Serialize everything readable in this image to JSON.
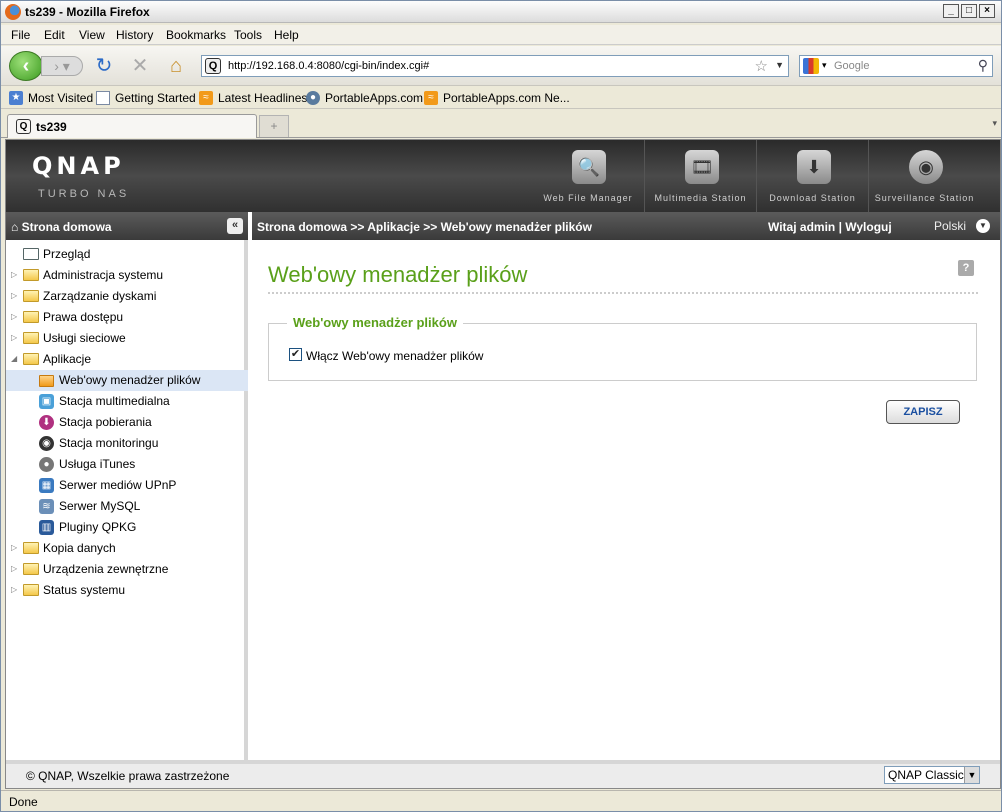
{
  "window": {
    "title": "ts239 - Mozilla Firefox"
  },
  "menu": [
    "File",
    "Edit",
    "View",
    "History",
    "Bookmarks",
    "Tools",
    "Help"
  ],
  "nav": {
    "url": "http://192.168.0.4:8080/cgi-bin/index.cgi#",
    "search_placeholder": "Google"
  },
  "bookmarks": [
    "Most Visited",
    "Getting Started",
    "Latest Headlines",
    "PortableApps.com",
    "PortableApps.com Ne..."
  ],
  "tab": {
    "label": "ts239",
    "new_tab": "+"
  },
  "qnap": {
    "logo": "QNAP",
    "sub": "TURBO NAS",
    "apps": [
      "Web File Manager",
      "Multimedia Station",
      "Download Station",
      "Surveillance Station"
    ]
  },
  "sidebar": {
    "header": "Strona domowa",
    "items": [
      {
        "label": "Przegląd"
      },
      {
        "label": "Administracja systemu"
      },
      {
        "label": "Zarządzanie dyskami"
      },
      {
        "label": "Prawa dostępu"
      },
      {
        "label": "Usługi sieciowe"
      },
      {
        "label": "Aplikacje"
      },
      {
        "label": "Web'owy menadżer plików"
      },
      {
        "label": "Stacja multimedialna"
      },
      {
        "label": "Stacja pobierania"
      },
      {
        "label": "Stacja monitoringu"
      },
      {
        "label": "Usługa iTunes"
      },
      {
        "label": "Serwer mediów UPnP"
      },
      {
        "label": "Serwer MySQL"
      },
      {
        "label": "Pluginy QPKG"
      },
      {
        "label": "Kopia danych"
      },
      {
        "label": "Urządzenia zewnętrzne"
      },
      {
        "label": "Status systemu"
      }
    ]
  },
  "breadcrumb": {
    "path": "Strona domowa >> Aplikacje >> Web'owy menadżer plików",
    "welcome": "Witaj admin | Wyloguj",
    "language": "Polski"
  },
  "main": {
    "title": "Web'owy menadżer plików",
    "fieldset_legend": "Web'owy menadżer plików",
    "checkbox_label": "Włącz Web'owy menadżer plików",
    "checkbox_checked": true,
    "save_label": "ZAPISZ"
  },
  "footer": {
    "copyright": "© QNAP, Wszelkie prawa zastrzeżone",
    "theme": "QNAP Classic"
  },
  "status": "Done"
}
